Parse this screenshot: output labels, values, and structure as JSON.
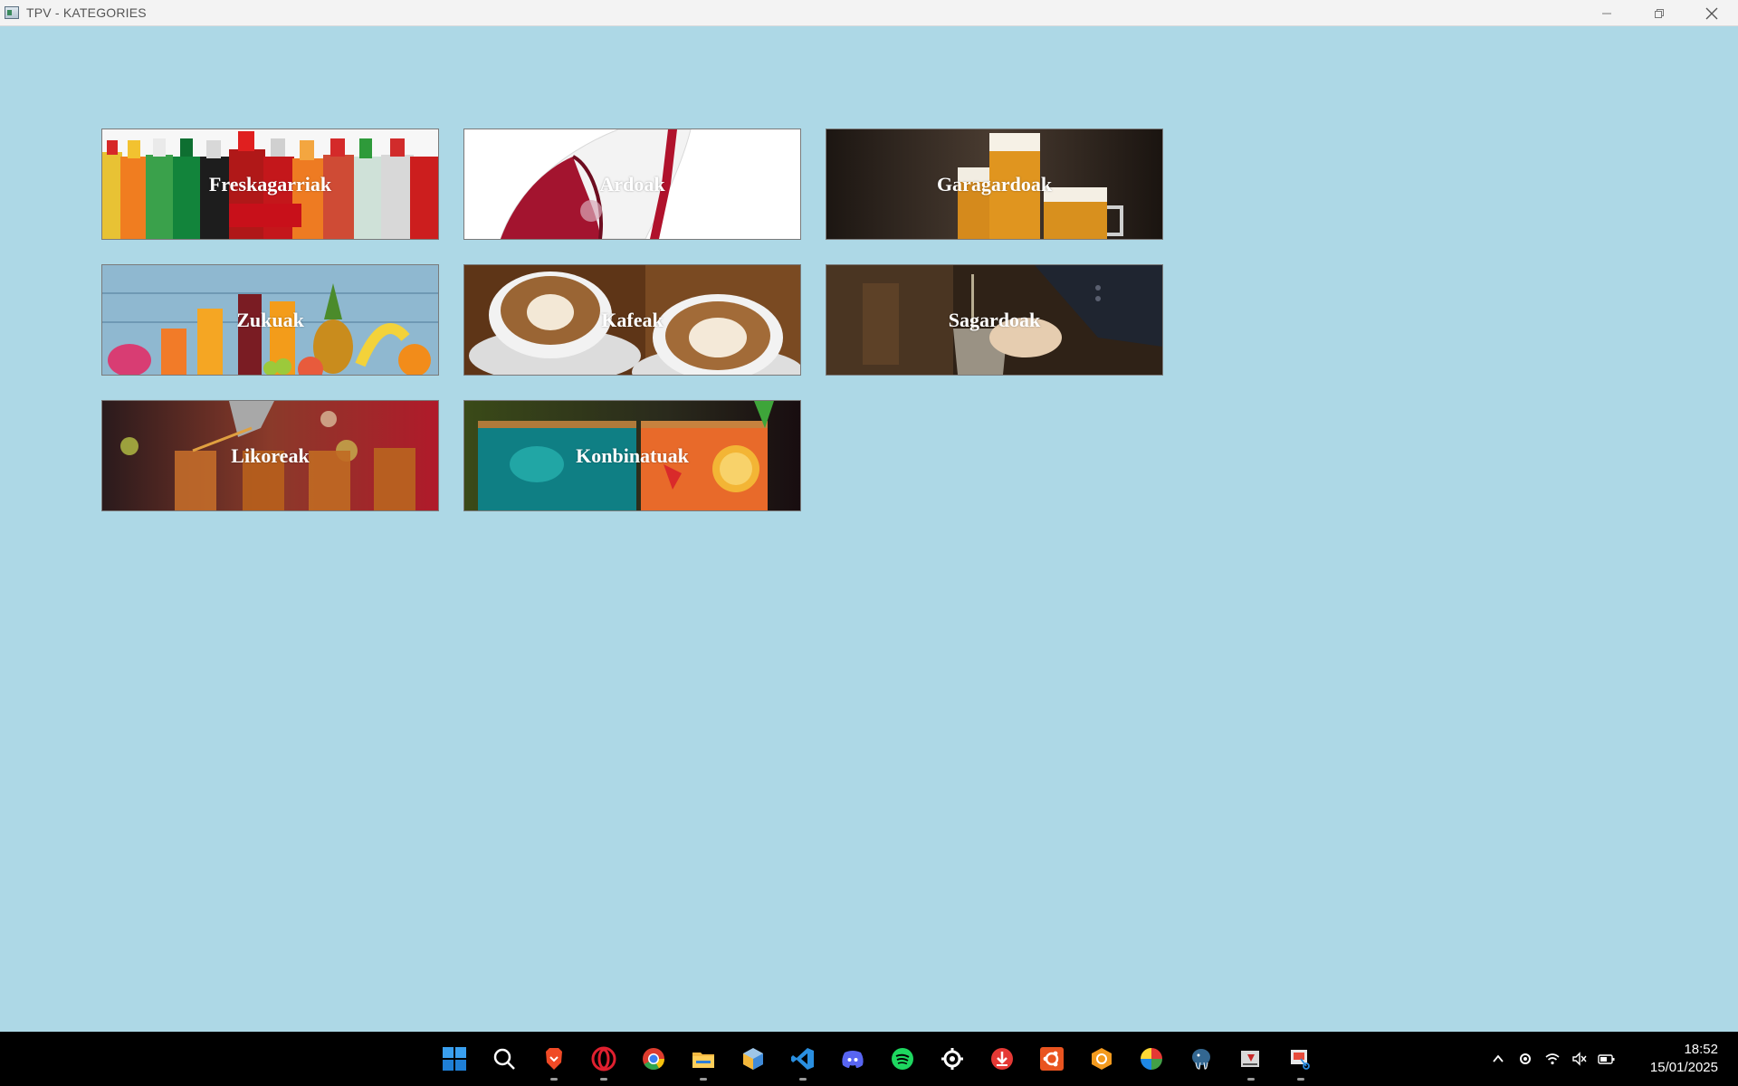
{
  "window": {
    "title": "TPV - KATEGORIES"
  },
  "categories": [
    {
      "label": "Freskagarriak"
    },
    {
      "label": "Ardoak"
    },
    {
      "label": "Garagardoak"
    },
    {
      "label": "Zukuak"
    },
    {
      "label": "Kafeak"
    },
    {
      "label": "Sagardoak"
    },
    {
      "label": "Likoreak"
    },
    {
      "label": "Konbinatuak"
    }
  ],
  "taskbar": {
    "apps": [
      {
        "icon": "windows-start-icon"
      },
      {
        "icon": "search-icon"
      },
      {
        "icon": "brave-browser-icon"
      },
      {
        "icon": "opera-browser-icon"
      },
      {
        "icon": "chrome-browser-icon"
      },
      {
        "icon": "file-explorer-icon"
      },
      {
        "icon": "cube-app-icon"
      },
      {
        "icon": "vscode-icon"
      },
      {
        "icon": "discord-icon"
      },
      {
        "icon": "spotify-icon"
      },
      {
        "icon": "steelseries-icon"
      },
      {
        "icon": "download-app-icon"
      },
      {
        "icon": "ubuntu-icon"
      },
      {
        "icon": "orange-app-icon"
      },
      {
        "icon": "color-wheel-icon"
      },
      {
        "icon": "postgresql-icon"
      },
      {
        "icon": "java-app-icon"
      },
      {
        "icon": "snipping-tool-icon"
      }
    ],
    "clock": {
      "time": "18:52",
      "date": "15/01/2025"
    }
  }
}
